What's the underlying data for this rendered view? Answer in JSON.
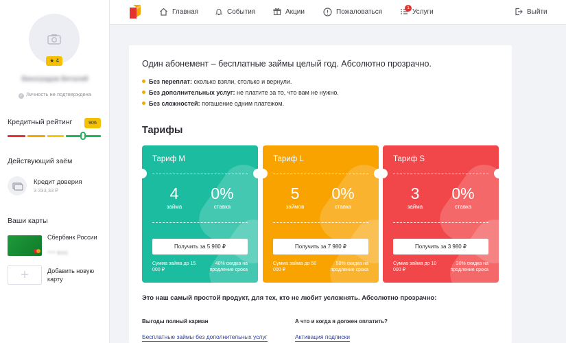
{
  "sidebar": {
    "user_name": "Виноградов Виталий",
    "rating_stars": "★ 4",
    "verify_text": "Личность не подтверждена",
    "credit_rating_title": "Кредитный рейтинг",
    "credit_rating_value": "906",
    "active_loan_title": "Действующий заём",
    "loan_name": "Кредит доверия",
    "loan_amount": "3 333,33 ₽",
    "cards_title": "Ваши карты",
    "card_bank": "Сбербанк России",
    "card_number": "**** 9031",
    "add_card_label": "Добавить новую карту"
  },
  "nav": {
    "home": "Главная",
    "events": "События",
    "promotions": "Акции",
    "complain": "Пожаловаться",
    "services": "Услуги",
    "services_badge": "1",
    "logout": "Выйти"
  },
  "main": {
    "headline": "Один абонемент – бесплатные займы целый год. Абсолютно прозрачно.",
    "bullets": [
      {
        "bold": "Без переплат:",
        "text": " сколько взяли, столько и вернули."
      },
      {
        "bold": "Без дополнительных услуг:",
        "text": " не платите за то, что вам не нужно."
      },
      {
        "bold": "Без сложностей:",
        "text": " погашение одним платежом."
      }
    ],
    "tariffs_title": "Тарифы",
    "tariffs": [
      {
        "name": "Тариф M",
        "loans": "4",
        "loans_label": "займа",
        "rate": "0%",
        "rate_label": "ставка",
        "button": "Получить за 5 980 ₽",
        "foot_left": "Сумма займа до 15 000 ₽",
        "foot_right": "40% скидка на продление срока",
        "color": "#1cbca0"
      },
      {
        "name": "Тариф L",
        "loans": "5",
        "loans_label": "займов",
        "rate": "0%",
        "rate_label": "ставка",
        "button": "Получить за 7 980 ₽",
        "foot_left": "Сумма займа до 50 000 ₽",
        "foot_right": "50% скидка на продление срока",
        "color": "#f9a300"
      },
      {
        "name": "Тариф S",
        "loans": "3",
        "loans_label": "займа",
        "rate": "0%",
        "rate_label": "ставка",
        "button": "Получить за 3 980 ₽",
        "foot_left": "Сумма займа до 10 000 ₽",
        "foot_right": "30% скидка на продление срока",
        "color": "#f2474a"
      }
    ],
    "simple_product": "Это наш самый простой продукт, для тех, кто не любит усложнять. Абсолютно прозрачно:",
    "col1_title": "Выгоды полный карман",
    "col1_link": "Бесплатные займы без дополнительных услуг",
    "col2_title": "А что и когда я должен оплатить?",
    "col2_link": "Активация подписки"
  }
}
